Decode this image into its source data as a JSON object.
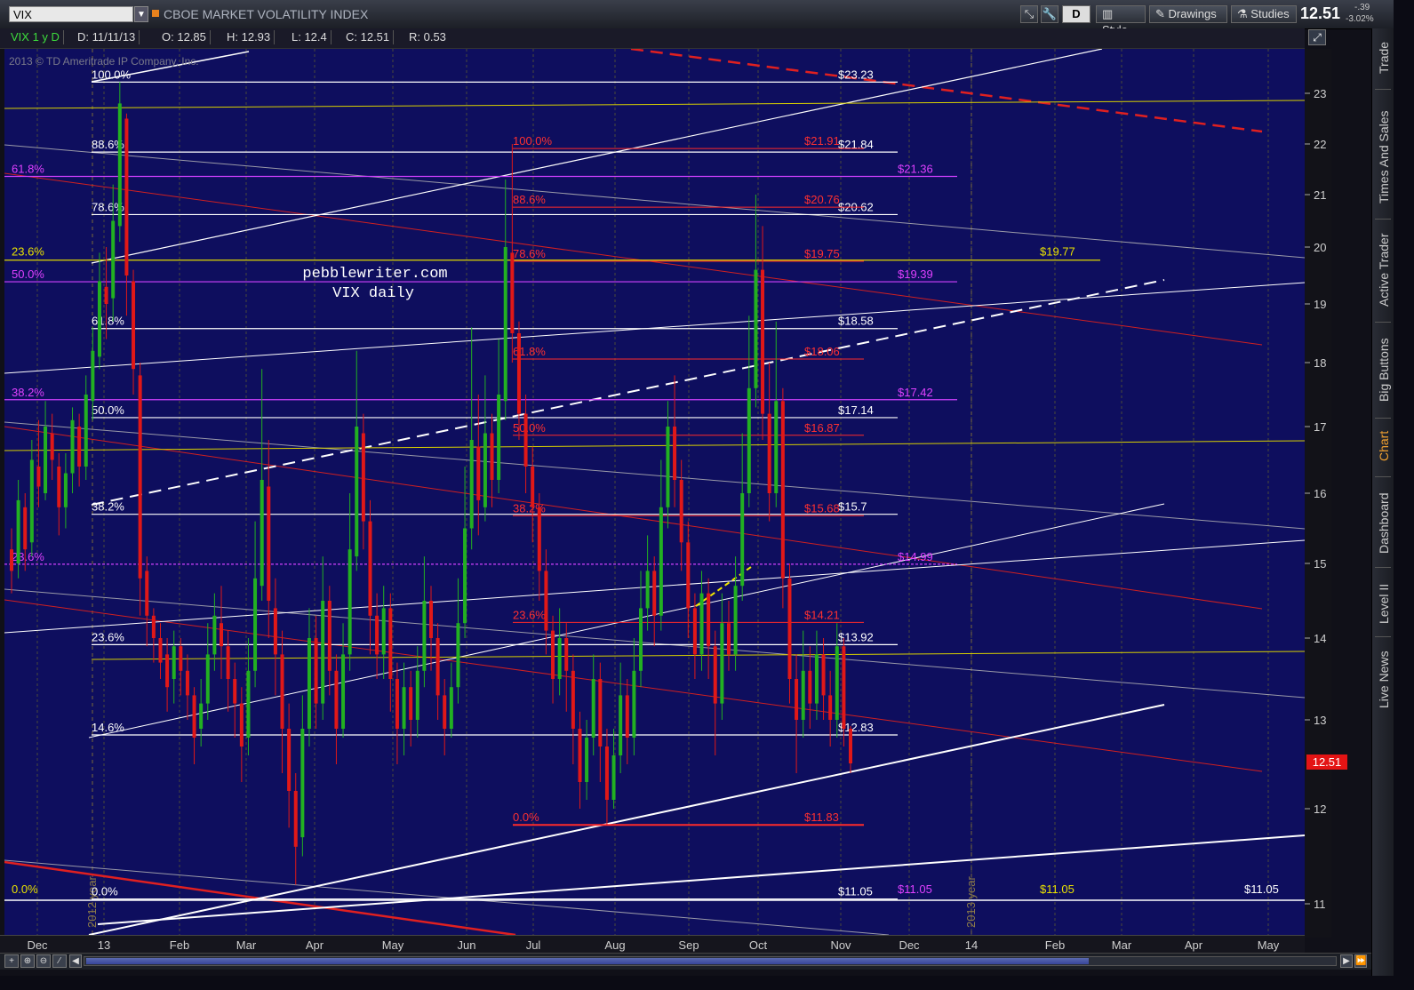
{
  "toolbar": {
    "symbol": "VIX",
    "symbol_description": "CBOE MARKET VOLATILITY INDEX",
    "aggregation_button": "D",
    "style_label": "Style",
    "drawings_label": "Drawings",
    "studies_label": "Studies",
    "last_price": "12.51",
    "change_abs": "-.39",
    "change_pct": "-3.02%"
  },
  "info_bar": {
    "period": "VIX 1 y D",
    "date": "D: 11/11/13",
    "open": "O: 12.85",
    "high": "H: 12.93",
    "low": "L: 12.4",
    "close": "C: 12.51",
    "range": "R: 0.53"
  },
  "copyright": "2013 © TD Ameritrade IP Company, Inc.",
  "watermark": {
    "line1": "pebblewriter.com",
    "line2": "VIX daily"
  },
  "right_tabs": [
    "Trade",
    "Times And Sales",
    "Active Trader",
    "Big Buttons",
    "Chart",
    "Dashboard",
    "Level II",
    "Live News"
  ],
  "current_price_label": "12.51",
  "colors": {
    "up": "#22b022",
    "down": "#e01818",
    "background": "#0e0e5e",
    "fib_white": "#ffffff",
    "fib_red": "#ff3030",
    "fib_magenta": "#e040ff",
    "fib_yellow": "#e8e000"
  },
  "chart_data": {
    "type": "candlestick",
    "symbol": "VIX",
    "yaxis": {
      "ticks": [
        11,
        12,
        13,
        14,
        15,
        16,
        17,
        18,
        19,
        20,
        21,
        22,
        23
      ]
    },
    "xaxis": {
      "ticks": [
        "Dec",
        "13",
        "Feb",
        "Mar",
        "Apr",
        "May",
        "Jun",
        "Jul",
        "Aug",
        "Sep",
        "Oct",
        "Nov",
        "Dec",
        "14",
        "Feb",
        "Mar",
        "Apr",
        "May"
      ]
    },
    "year_markers": [
      "2012 year",
      "2013 year"
    ],
    "fib_white": {
      "percent_labels": [
        "100.0%",
        "88.6%",
        "78.6%",
        "61.8%",
        "50.0%",
        "38.2%",
        "23.6%",
        "14.6%",
        "0.0%"
      ],
      "values": [
        23.23,
        21.84,
        20.62,
        18.58,
        17.14,
        15.7,
        13.92,
        12.83,
        11.05
      ],
      "price_labels": [
        "$23.23",
        "$21.84",
        "$20.62",
        "$18.58",
        "$17.14",
        "$15.7",
        "$13.92",
        "$12.83",
        "$11.05"
      ]
    },
    "fib_red": {
      "percent_labels": [
        "100.0%",
        "88.6%",
        "78.6%",
        "61.8%",
        "50.0%",
        "38.2%",
        "23.6%",
        "0.0%"
      ],
      "values": [
        21.91,
        20.76,
        19.75,
        18.06,
        16.87,
        15.68,
        14.21,
        11.83
      ],
      "price_labels": [
        "$21.91",
        "$20.76",
        "$19.75",
        "$18.06",
        "$16.87",
        "$15.68",
        "$14.21",
        "$11.83"
      ]
    },
    "fib_magenta": {
      "percent_labels": [
        "61.8%",
        "50.0%",
        "38.2%",
        "23.6%"
      ],
      "values": [
        21.36,
        19.39,
        17.42,
        14.99
      ],
      "price_labels": [
        "$21.36",
        "$19.39",
        "$17.42",
        "$14.99",
        "$11.05"
      ]
    },
    "fib_yellow": {
      "percent_labels": [
        "23.6%",
        "0.0%"
      ],
      "price_labels": [
        "$19.77",
        "$11.05"
      ],
      "values": [
        19.77,
        11.05
      ]
    },
    "right_label": "$11.05",
    "candles": [
      [
        0,
        15.2,
        14.9,
        15.5,
        14.6
      ],
      [
        1,
        15.0,
        15.9,
        16.2,
        14.8
      ],
      [
        2,
        15.8,
        15.2,
        16.0,
        14.9
      ],
      [
        3,
        15.3,
        16.5,
        16.8,
        15.1
      ],
      [
        4,
        16.4,
        16.1,
        17.1,
        15.8
      ],
      [
        5,
        16.0,
        17.0,
        17.4,
        15.9
      ],
      [
        6,
        16.9,
        16.5,
        17.2,
        16.2
      ],
      [
        7,
        16.4,
        15.8,
        16.6,
        15.4
      ],
      [
        8,
        15.8,
        16.3,
        16.6,
        15.5
      ],
      [
        9,
        16.3,
        17.1,
        17.3,
        16.0
      ],
      [
        10,
        17.0,
        16.4,
        17.2,
        16.1
      ],
      [
        11,
        16.4,
        17.5,
        17.8,
        16.2
      ],
      [
        12,
        17.4,
        18.2,
        18.6,
        17.1
      ],
      [
        13,
        18.1,
        19.4,
        19.9,
        17.9
      ],
      [
        14,
        19.3,
        19.0,
        20.0,
        18.4
      ],
      [
        15,
        19.1,
        20.5,
        21.2,
        18.7
      ],
      [
        16,
        20.4,
        22.8,
        23.23,
        20.1
      ],
      [
        17,
        22.5,
        19.5,
        22.6,
        18.8
      ],
      [
        18,
        19.4,
        17.9,
        19.6,
        17.5
      ],
      [
        19,
        17.8,
        14.8,
        18.0,
        14.3
      ],
      [
        20,
        14.9,
        14.3,
        15.1,
        13.9
      ],
      [
        21,
        14.3,
        14.0,
        14.4,
        13.7
      ],
      [
        22,
        14.0,
        13.7,
        14.2,
        13.5
      ],
      [
        23,
        13.8,
        13.4,
        14.0,
        13.1
      ],
      [
        24,
        13.5,
        13.9,
        14.1,
        13.2
      ],
      [
        25,
        13.9,
        13.6,
        14.0,
        13.3
      ],
      [
        26,
        13.6,
        13.3,
        13.8,
        13.0
      ],
      [
        27,
        13.3,
        12.8,
        13.4,
        12.5
      ],
      [
        28,
        12.9,
        13.2,
        13.5,
        12.7
      ],
      [
        29,
        13.2,
        13.8,
        14.2,
        13.0
      ],
      [
        30,
        13.8,
        14.3,
        14.6,
        13.6
      ],
      [
        31,
        14.2,
        13.9,
        14.7,
        13.5
      ],
      [
        32,
        13.9,
        13.5,
        14.1,
        13.1
      ],
      [
        33,
        13.5,
        13.2,
        13.7,
        12.8
      ],
      [
        34,
        13.2,
        12.7,
        13.4,
        12.3
      ],
      [
        35,
        12.8,
        13.6,
        14.0,
        12.6
      ],
      [
        36,
        13.6,
        14.8,
        15.6,
        13.4
      ],
      [
        37,
        14.7,
        16.2,
        17.9,
        14.5
      ],
      [
        38,
        16.1,
        14.5,
        16.8,
        14.0
      ],
      [
        39,
        14.4,
        13.8,
        14.8,
        13.3
      ],
      [
        40,
        13.8,
        12.9,
        14.1,
        12.4
      ],
      [
        41,
        12.9,
        12.2,
        13.2,
        11.8
      ],
      [
        42,
        12.2,
        11.6,
        12.4,
        11.2
      ],
      [
        43,
        11.7,
        12.9,
        13.3,
        11.5
      ],
      [
        44,
        12.9,
        14.0,
        14.4,
        12.7
      ],
      [
        45,
        14.0,
        13.2,
        14.3,
        12.9
      ],
      [
        46,
        13.2,
        14.5,
        15.1,
        13.0
      ],
      [
        47,
        14.5,
        13.6,
        14.7,
        13.3
      ],
      [
        48,
        13.6,
        12.9,
        13.8,
        12.5
      ],
      [
        49,
        12.9,
        13.8,
        14.2,
        12.8
      ],
      [
        50,
        13.8,
        15.2,
        16.0,
        13.6
      ],
      [
        51,
        15.1,
        17.0,
        18.2,
        14.9
      ],
      [
        52,
        16.9,
        15.6,
        17.2,
        15.2
      ],
      [
        53,
        15.6,
        14.3,
        15.9,
        13.8
      ],
      [
        54,
        14.3,
        13.8,
        14.6,
        13.5
      ],
      [
        55,
        13.8,
        14.4,
        14.7,
        13.5
      ],
      [
        56,
        14.4,
        13.5,
        14.6,
        13.1
      ],
      [
        57,
        13.5,
        12.9,
        13.7,
        12.5
      ],
      [
        58,
        12.9,
        13.4,
        13.7,
        12.6
      ],
      [
        59,
        13.4,
        13.0,
        13.6,
        12.7
      ],
      [
        60,
        13.0,
        13.6,
        13.9,
        12.8
      ],
      [
        61,
        13.6,
        14.5,
        15.1,
        13.4
      ],
      [
        62,
        14.5,
        14.0,
        14.7,
        13.6
      ],
      [
        63,
        14.0,
        13.3,
        14.2,
        13.0
      ],
      [
        64,
        13.3,
        12.9,
        13.5,
        12.6
      ],
      [
        65,
        12.9,
        13.4,
        13.7,
        12.8
      ],
      [
        66,
        13.4,
        14.2,
        14.8,
        13.2
      ],
      [
        67,
        14.2,
        15.5,
        16.4,
        14.0
      ],
      [
        68,
        15.5,
        16.8,
        18.6,
        15.2
      ],
      [
        69,
        16.7,
        15.9,
        17.5,
        15.4
      ],
      [
        70,
        15.8,
        16.9,
        17.8,
        15.6
      ],
      [
        71,
        16.9,
        16.2,
        17.2,
        15.8
      ],
      [
        72,
        16.2,
        17.5,
        18.4,
        16.0
      ],
      [
        73,
        17.4,
        20.0,
        21.3,
        17.1
      ],
      [
        74,
        19.9,
        18.5,
        22.0,
        18.0
      ],
      [
        75,
        18.5,
        17.2,
        18.7,
        16.8
      ],
      [
        76,
        17.2,
        16.4,
        17.5,
        16.0
      ],
      [
        77,
        16.4,
        15.8,
        16.7,
        15.3
      ],
      [
        78,
        15.8,
        14.9,
        16.0,
        14.5
      ],
      [
        79,
        14.9,
        14.1,
        15.2,
        13.8
      ],
      [
        80,
        14.1,
        13.5,
        14.3,
        13.2
      ],
      [
        81,
        13.5,
        14.0,
        14.4,
        13.3
      ],
      [
        82,
        14.0,
        13.6,
        14.2,
        13.1
      ],
      [
        83,
        13.6,
        12.9,
        13.8,
        12.5
      ],
      [
        84,
        12.9,
        12.3,
        13.1,
        12.0
      ],
      [
        85,
        12.3,
        12.8,
        13.0,
        12.1
      ],
      [
        86,
        12.8,
        13.5,
        13.8,
        12.6
      ],
      [
        87,
        13.5,
        12.7,
        13.7,
        12.3
      ],
      [
        88,
        12.7,
        12.1,
        12.9,
        11.83
      ],
      [
        89,
        12.1,
        12.6,
        12.9,
        12.0
      ],
      [
        90,
        12.6,
        13.3,
        13.7,
        12.4
      ],
      [
        91,
        13.3,
        12.8,
        13.5,
        12.5
      ],
      [
        92,
        12.8,
        13.6,
        14.0,
        12.6
      ],
      [
        93,
        13.6,
        14.4,
        14.9,
        13.4
      ],
      [
        94,
        14.4,
        14.9,
        15.4,
        14.1
      ],
      [
        95,
        14.9,
        14.3,
        15.1,
        13.9
      ],
      [
        96,
        14.3,
        15.8,
        16.5,
        14.1
      ],
      [
        97,
        15.8,
        17.0,
        17.4,
        15.5
      ],
      [
        98,
        17.0,
        16.2,
        17.8,
        15.8
      ],
      [
        99,
        16.2,
        15.3,
        16.5,
        14.9
      ],
      [
        100,
        15.3,
        14.4,
        15.6,
        14.0
      ],
      [
        101,
        14.4,
        13.8,
        14.6,
        13.5
      ],
      [
        102,
        13.8,
        14.6,
        14.9,
        13.6
      ],
      [
        103,
        14.6,
        13.9,
        14.8,
        13.5
      ],
      [
        104,
        13.9,
        13.2,
        14.1,
        12.6
      ],
      [
        105,
        13.2,
        14.2,
        14.6,
        13.0
      ],
      [
        106,
        14.2,
        13.8,
        14.5,
        13.6
      ],
      [
        107,
        13.8,
        14.7,
        15.1,
        13.6
      ],
      [
        108,
        14.7,
        16.0,
        16.9,
        14.5
      ],
      [
        109,
        16.0,
        17.6,
        18.8,
        15.8
      ],
      [
        110,
        17.6,
        19.6,
        21.0,
        17.3
      ],
      [
        111,
        19.6,
        17.2,
        20.4,
        16.8
      ],
      [
        112,
        17.2,
        16.0,
        18.0,
        15.6
      ],
      [
        113,
        16.0,
        17.4,
        18.7,
        15.8
      ],
      [
        114,
        17.4,
        14.8,
        17.6,
        14.4
      ],
      [
        115,
        14.8,
        13.5,
        15.0,
        13.2
      ],
      [
        116,
        13.5,
        13.0,
        13.8,
        12.4
      ],
      [
        117,
        13.0,
        13.6,
        14.1,
        12.8
      ],
      [
        118,
        13.6,
        13.2,
        13.9,
        12.9
      ],
      [
        119,
        13.2,
        13.8,
        14.1,
        13.0
      ],
      [
        120,
        13.8,
        13.3,
        14.0,
        13.0
      ],
      [
        121,
        13.3,
        13.0,
        13.6,
        12.7
      ],
      [
        122,
        13.0,
        13.9,
        14.2,
        12.8
      ],
      [
        123,
        13.9,
        12.9,
        14.0,
        12.7
      ],
      [
        124,
        12.9,
        12.51,
        12.93,
        12.4
      ]
    ]
  }
}
